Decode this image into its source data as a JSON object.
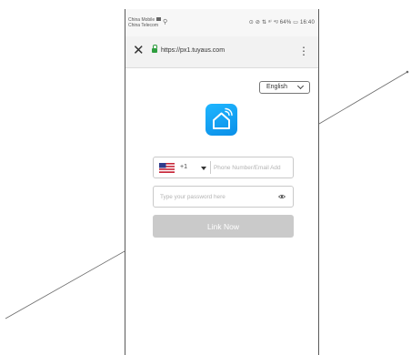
{
  "status_bar": {
    "carrier_line1": "China Mobile",
    "carrier_line2": "China Telecom",
    "right_text": "⊙ ⊘ ⇅ ᵃⁱ ⁴ᵍ 64% ▭ 16:40"
  },
  "browser": {
    "url": "https://px1.tuyaus.com",
    "close_glyph": "✕",
    "menu_glyph": "⋮"
  },
  "language": {
    "selected": "English"
  },
  "login": {
    "country_code": "+1",
    "phone_placeholder": "Phone Number/Email Add",
    "password_placeholder": "Type your password here",
    "submit_label": "Link Now"
  },
  "colors": {
    "accent": "#0b8fe8",
    "button_disabled": "#cacaca",
    "secure_lock": "#2e9e3f"
  },
  "icons": [
    "close-icon",
    "lock-icon",
    "menu-icon",
    "chevron-down-icon",
    "home-wifi-icon",
    "us-flag-icon",
    "eye-icon"
  ]
}
